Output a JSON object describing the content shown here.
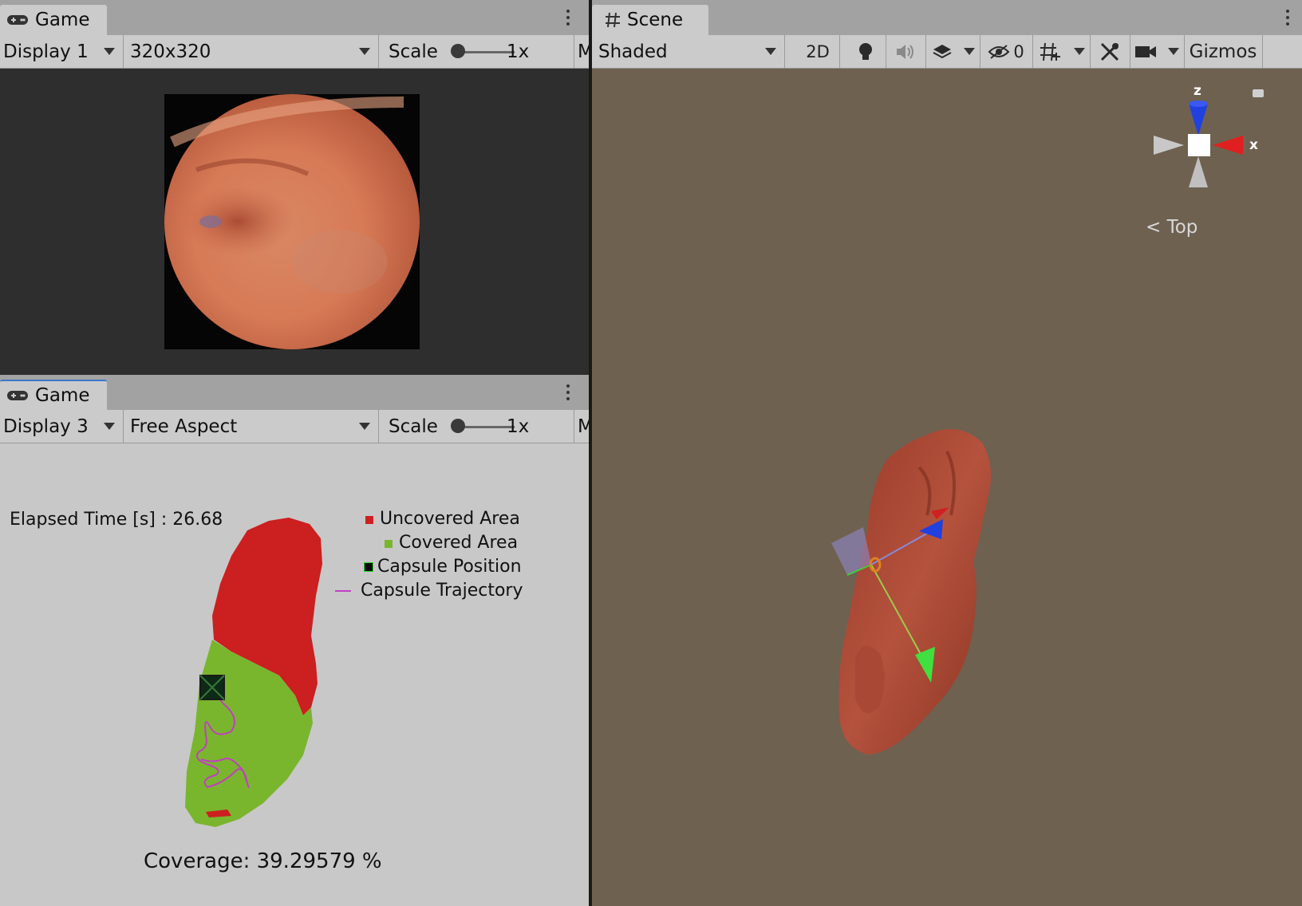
{
  "game_top": {
    "tab_label": "Game",
    "display": "Display 1",
    "resolution": "320x320",
    "scale_label": "Scale",
    "scale_value": "1x",
    "overflow": "M"
  },
  "game_bottom": {
    "tab_label": "Game",
    "display": "Display 3",
    "resolution": "Free Aspect",
    "scale_label": "Scale",
    "scale_value": "1x",
    "overflow": "M",
    "elapsed_time": "Elapsed Time [s] : 26.68",
    "coverage": "Coverage: 39.29579 %",
    "legend": {
      "uncovered": "Uncovered Area",
      "covered": "Covered Area",
      "capsule_position": "Capsule Position",
      "capsule_trajectory": "Capsule Trajectory"
    },
    "colors": {
      "uncovered": "#cc1f1f",
      "covered": "#7ab52e",
      "trajectory": "#c040c0"
    }
  },
  "scene": {
    "tab_label": "Scene",
    "shading_mode": "Shaded",
    "mode_2d": "2D",
    "hidden_count": "0",
    "gizmos": "Gizmos",
    "gizmo_view": "Top",
    "axis_z": "z",
    "axis_x": "x",
    "background": "#6e6150"
  }
}
